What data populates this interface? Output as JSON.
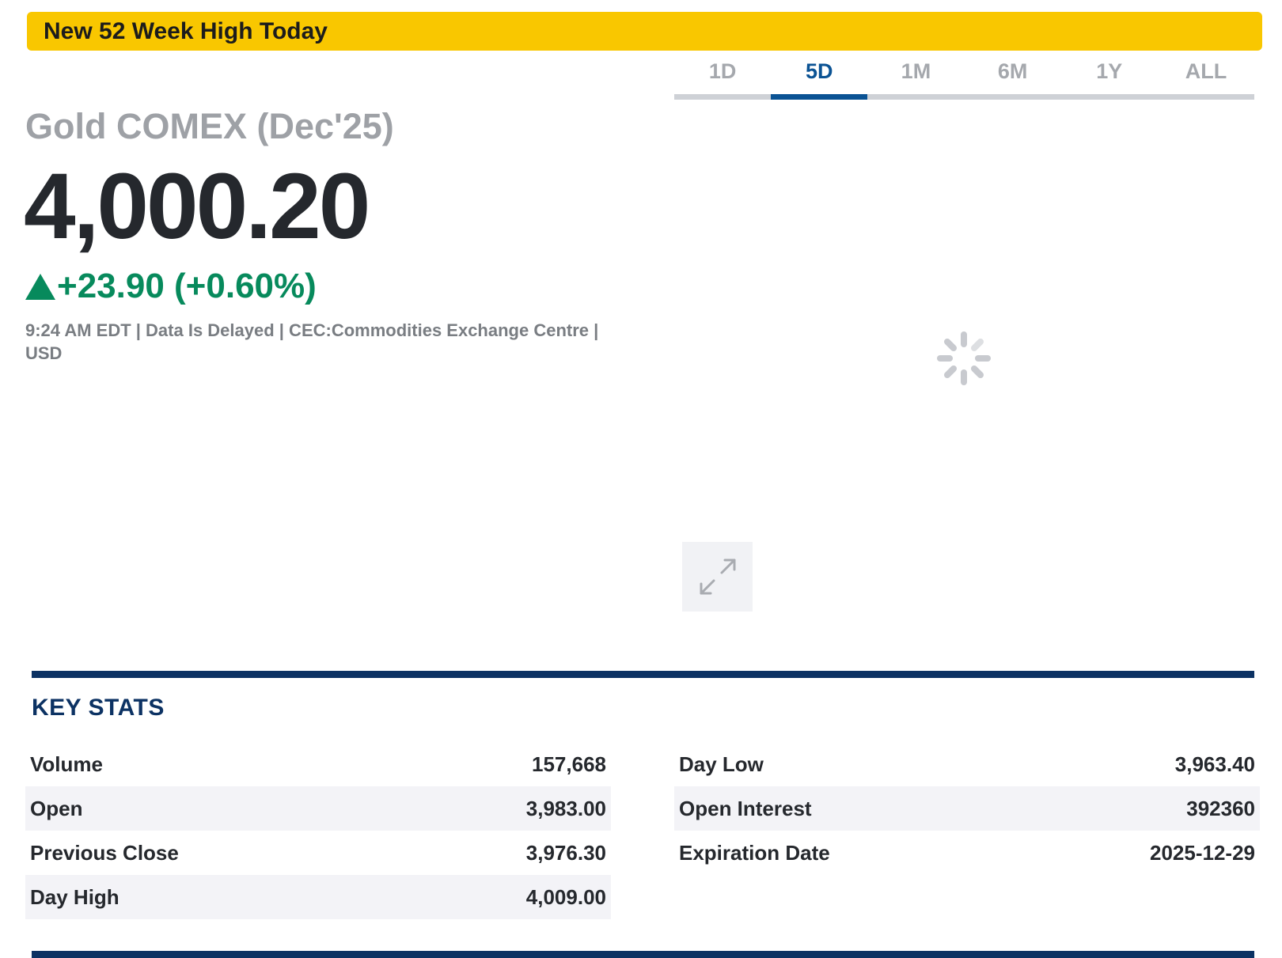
{
  "banner": {
    "text": "New 52 Week High Today"
  },
  "tabs": [
    {
      "label": "1D",
      "active": false
    },
    {
      "label": "5D",
      "active": true
    },
    {
      "label": "1M",
      "active": false
    },
    {
      "label": "6M",
      "active": false
    },
    {
      "label": "1Y",
      "active": false
    },
    {
      "label": "ALL",
      "active": false
    }
  ],
  "quote": {
    "name": "Gold COMEX (Dec'25)",
    "price": "4,000.20",
    "change": "+23.90 (+0.60%)",
    "direction": "up",
    "meta": "9:24 AM EDT | Data Is Delayed | CEC:Commodities Exchange Centre | USD"
  },
  "chart_area": {
    "loading_icon": "spinner-icon",
    "expand_icon": "expand-icon"
  },
  "key_stats": {
    "title": "KEY STATS",
    "left": [
      {
        "label": "Volume",
        "value": "157,668"
      },
      {
        "label": "Open",
        "value": "3,983.00"
      },
      {
        "label": "Previous Close",
        "value": "3,976.30"
      },
      {
        "label": "Day High",
        "value": "4,009.00"
      }
    ],
    "right": [
      {
        "label": "Day Low",
        "value": "3,963.40"
      },
      {
        "label": "Open Interest",
        "value": "392360"
      },
      {
        "label": "Expiration Date",
        "value": "2025-12-29"
      }
    ]
  },
  "colors": {
    "banner": "#f9c700",
    "active_tab": "#0b5394",
    "positive": "#078a5c",
    "navy": "#0c3263"
  }
}
